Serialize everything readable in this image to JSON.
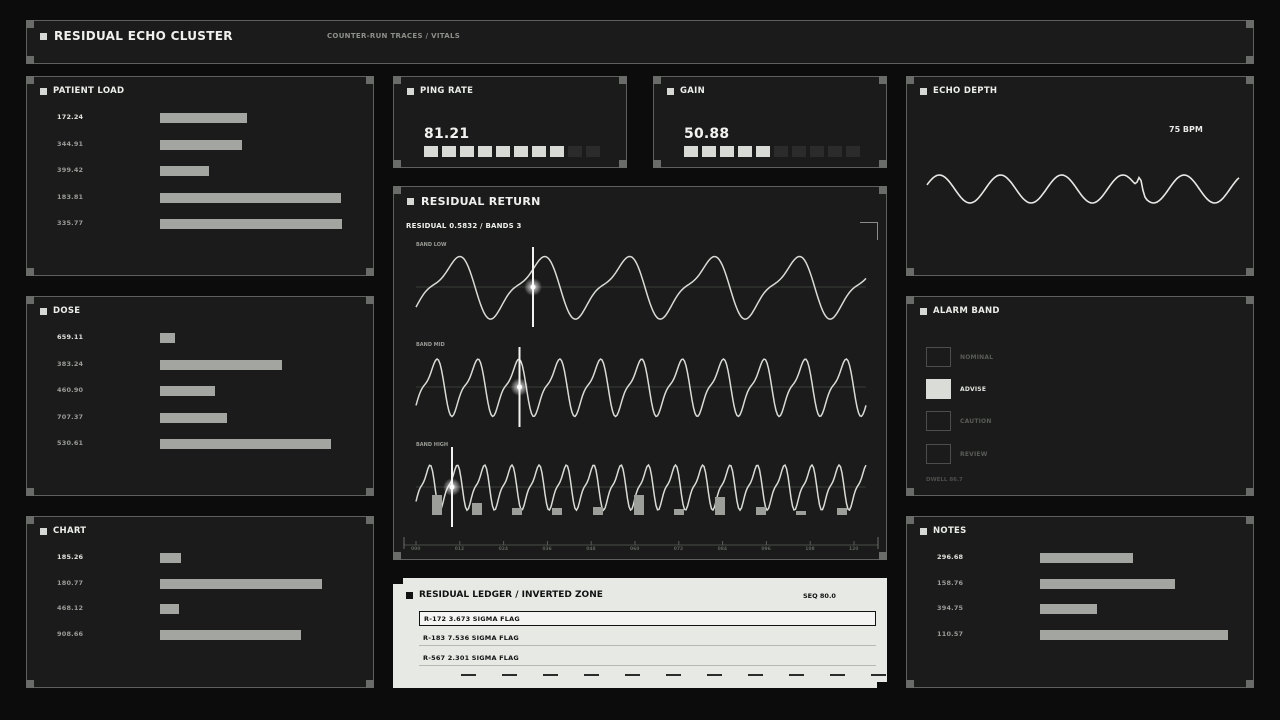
{
  "header": {
    "title": "RESIDUAL ECHO CLUSTER",
    "subtitle": "COUNTER-RUN TRACES / VITALS"
  },
  "patient_load": {
    "title": "PATIENT LOAD",
    "rows": [
      {
        "label": "172.24",
        "fraction": 0.46
      },
      {
        "label": "344.91",
        "fraction": 0.43
      },
      {
        "label": "399.42",
        "fraction": 0.26
      },
      {
        "label": "183.81",
        "fraction": 0.95
      },
      {
        "label": "335.77",
        "fraction": 0.96
      }
    ]
  },
  "dose": {
    "title": "DOSE",
    "rows": [
      {
        "label": "659.11",
        "fraction": 0.08
      },
      {
        "label": "383.24",
        "fraction": 0.64
      },
      {
        "label": "460.90",
        "fraction": 0.29
      },
      {
        "label": "707.37",
        "fraction": 0.35
      },
      {
        "label": "530.61",
        "fraction": 0.9
      }
    ]
  },
  "chart": {
    "title": "CHART",
    "rows": [
      {
        "label": "185.26",
        "fraction": 0.11
      },
      {
        "label": "180.77",
        "fraction": 0.85
      },
      {
        "label": "468.12",
        "fraction": 0.1
      },
      {
        "label": "908.66",
        "fraction": 0.74
      }
    ]
  },
  "ping_rate": {
    "title": "PING RATE",
    "value": "81.21",
    "segments_total": 10,
    "segments_on": 8
  },
  "gain": {
    "title": "GAIN",
    "value": "50.88",
    "segments_total": 10,
    "segments_on": 5
  },
  "echo_depth": {
    "title": "ECHO DEPTH",
    "rate": "75 BPM"
  },
  "alarm_band": {
    "title": "ALARM BAND",
    "items": [
      {
        "label": "NOMINAL",
        "active": false
      },
      {
        "label": "ADVISE",
        "active": true
      },
      {
        "label": "CAUTION",
        "active": false
      },
      {
        "label": "REVIEW",
        "active": false
      }
    ],
    "dwell": "DWELL 86.7"
  },
  "notes": {
    "title": "NOTES",
    "rows": [
      {
        "label": "296.68",
        "fraction": 0.49
      },
      {
        "label": "158.76",
        "fraction": 0.71
      },
      {
        "label": "394.75",
        "fraction": 0.3
      },
      {
        "label": "110.57",
        "fraction": 0.99
      }
    ]
  },
  "residual_return": {
    "title": "RESIDUAL RETURN",
    "readout": "RESIDUAL 0.5832 / BANDS 3",
    "bands": [
      {
        "label": "BAND LOW",
        "cursor_fraction": 0.26
      },
      {
        "label": "BAND MID",
        "cursor_fraction": 0.23
      },
      {
        "label": "BAND HIGH",
        "cursor_fraction": 0.08
      }
    ],
    "axis_ticks": [
      "000",
      "012",
      "024",
      "036",
      "048",
      "060",
      "072",
      "084",
      "096",
      "108",
      "120"
    ]
  },
  "ledger": {
    "title": "RESIDUAL LEDGER / INVERTED ZONE",
    "seq": "SEQ 80.0",
    "rows": [
      {
        "text": "R-172  3.673 SIGMA  FLAG",
        "selected": true
      },
      {
        "text": "R-183  7.536 SIGMA  FLAG",
        "selected": false
      },
      {
        "text": "R-567  2.301 SIGMA  FLAG",
        "selected": false
      }
    ]
  },
  "colors": {
    "background": "#0b0c0b",
    "panel": "#1a1b1a",
    "bar": "#a3a5a1",
    "trace": "#d9dbd6",
    "ledger_bg": "#e7e9e5"
  }
}
